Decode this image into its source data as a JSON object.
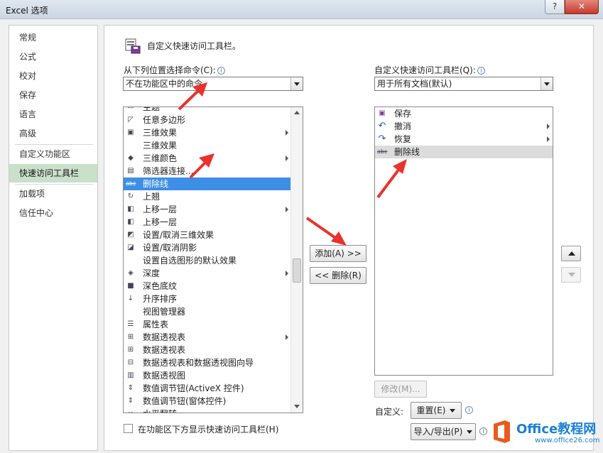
{
  "window": {
    "title": "Excel 选项",
    "help_label": "?",
    "close_label": "✕"
  },
  "sidebar": {
    "items": [
      {
        "label": "常规"
      },
      {
        "label": "公式"
      },
      {
        "label": "校对"
      },
      {
        "label": "保存"
      },
      {
        "label": "语言"
      },
      {
        "label": "高级"
      },
      {
        "label": "自定义功能区"
      },
      {
        "label": "快速访问工具栏",
        "active": true
      },
      {
        "label": "加载项"
      },
      {
        "label": "信任中心"
      }
    ]
  },
  "header": {
    "title": "自定义快速访问工具栏。",
    "icon": "qat-icon"
  },
  "left": {
    "label": "从下列位置选择命令(C):",
    "combo_value": "不在功能区中的命令",
    "commands": [
      {
        "label": "主题",
        "icon": "theme-icon",
        "submenu": false
      },
      {
        "label": "任意多边形",
        "icon": "freeform-icon",
        "submenu": false
      },
      {
        "label": "三维效果",
        "icon": "3d-effect-icon",
        "submenu": true
      },
      {
        "label": "三维效果",
        "icon": "",
        "submenu": false,
        "dropdown": true
      },
      {
        "label": "三维颜色",
        "icon": "3d-color-icon",
        "submenu": true
      },
      {
        "label": "筛选器连接...",
        "icon": "filter-icon",
        "submenu": false
      },
      {
        "label": "删除线",
        "icon": "strikethrough-icon",
        "submenu": false,
        "selected": true
      },
      {
        "label": "上翘",
        "icon": "rotate-icon",
        "submenu": false
      },
      {
        "label": "上移一层",
        "icon": "bring-forward-icon",
        "submenu": true
      },
      {
        "label": "上移一层",
        "icon": "bring-forward-icon",
        "submenu": false
      },
      {
        "label": "设置/取消三维效果",
        "icon": "toggle-3d-icon",
        "submenu": false
      },
      {
        "label": "设置/取消阴影",
        "icon": "toggle-shadow-icon",
        "submenu": false
      },
      {
        "label": "设置自选图形的默认效果",
        "icon": "",
        "submenu": false
      },
      {
        "label": "深度",
        "icon": "depth-icon",
        "submenu": true
      },
      {
        "label": "深色底纹",
        "icon": "dark-shade-icon",
        "submenu": false
      },
      {
        "label": "升序排序",
        "icon": "sort-asc-icon",
        "submenu": false
      },
      {
        "label": "视图管理器",
        "icon": "",
        "submenu": false,
        "dropdown2": true
      },
      {
        "label": "属性表",
        "icon": "property-icon",
        "submenu": false
      },
      {
        "label": "数据透视表",
        "icon": "pivot-icon",
        "submenu": true
      },
      {
        "label": "数据透视表",
        "icon": "pivot-icon",
        "submenu": false
      },
      {
        "label": "数据透视表和数据透视图向导",
        "icon": "pivot-wizard-icon",
        "submenu": false
      },
      {
        "label": "数据透视图",
        "icon": "pivot-chart-icon",
        "submenu": false
      },
      {
        "label": "数值调节钮(ActiveX 控件)",
        "icon": "spin-icon",
        "submenu": false
      },
      {
        "label": "数值调节钮(窗体控件)",
        "icon": "spin-icon",
        "submenu": false
      },
      {
        "label": "水平翻转",
        "icon": "flip-icon",
        "submenu": false
      }
    ],
    "show_below_label": "在功能区下方显示快速访问工具栏(H)"
  },
  "middle": {
    "add_label": "添加(A) >>",
    "remove_label": "<< 删除(R)"
  },
  "right": {
    "label": "自定义快速访问工具栏(Q):",
    "combo_value": "用于所有文档(默认)",
    "items": [
      {
        "label": "保存",
        "icon": "save-icon",
        "submenu": false
      },
      {
        "label": "撤消",
        "icon": "undo-icon",
        "submenu": true
      },
      {
        "label": "恢复",
        "icon": "redo-icon",
        "submenu": true
      },
      {
        "label": "删除线",
        "icon": "strikethrough-icon",
        "submenu": false,
        "highlighted": true
      }
    ],
    "modify_label": "修改(M)...",
    "customize_label": "自定义:",
    "reset_label": "重置(E)",
    "import_export_label": "导入/导出(P)"
  },
  "watermark": {
    "brand": "Office教程网",
    "url": "www.office26.com"
  },
  "colors": {
    "selection": "#3d8ee6",
    "active_nav": "#c9e0c9",
    "annotation": "#e8332c",
    "brand": "#1a7fd6"
  }
}
